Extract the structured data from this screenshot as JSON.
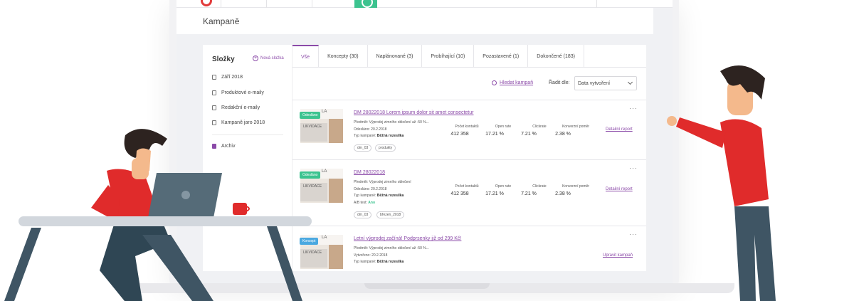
{
  "page": {
    "title": "Kampaně"
  },
  "sidebar": {
    "heading": "Složky",
    "new_folder": "Nová složka",
    "folders": [
      {
        "label": "Září 2018"
      },
      {
        "label": "Produktové e-maily"
      },
      {
        "label": "Redakční e-maily"
      },
      {
        "label": "Kampaně jaro 2018"
      }
    ],
    "archive": "Archiv"
  },
  "tabs": [
    {
      "label": "Vše"
    },
    {
      "label": "Koncepty (30)"
    },
    {
      "label": "Naplánované (3)"
    },
    {
      "label": "Probíhající (10)"
    },
    {
      "label": "Pozastavené (1)"
    },
    {
      "label": "Dokončené (183)"
    }
  ],
  "tools": {
    "search_label": "Hledat kampaň",
    "sort_label": "Řadit dle:",
    "sort_value": "Data vytvoření"
  },
  "stat_labels": {
    "contacts": "Počet kontaktů",
    "open_rate": "Open rate",
    "clickrate": "Clickrate",
    "conversion": "Konverzní poměr"
  },
  "campaigns": [
    {
      "badge": "Odesláno",
      "title": "DM 28022018 Lorem ipsum dolor sit amet consectetur",
      "subject": "Předmět: Výprodej zimního oblečení až -50 %...",
      "sent": "Odesláno: 20.2.2018",
      "type_label": "Typ kampaně:",
      "type_value": "Běžná rozesílka",
      "tags": [
        "dm_03",
        "produkty"
      ],
      "contacts": "412 358",
      "open_rate": "17.21 %",
      "clickrate": "7.21 %",
      "conversion": "2.38 %",
      "action": "Detailní report"
    },
    {
      "badge": "Odesláno",
      "title": "DM 28022018",
      "subject": "Předmět: Výprodej zimního oblečení",
      "sent": "Odesláno: 20.2.2018",
      "type_label": "Typ kampaně:",
      "type_value": "Běžná rozesílka",
      "ab_label": "A/B test:",
      "ab_value": "Ano",
      "tags": [
        "dm_03",
        "březen_2018"
      ],
      "contacts": "412 358",
      "open_rate": "17.21 %",
      "clickrate": "7.21 %",
      "conversion": "2.38 %",
      "action": "Detailní report"
    },
    {
      "badge": "Koncept",
      "title": "Letní výprodej začíná! Podprsenky již od 299 Kč!",
      "subject": "Předmět: Výprodej zimního oblečení až -50 %...",
      "sent": "Vytvořeno: 20.2.2018",
      "type_label": "Typ kampaně:",
      "type_value": "Běžná rozesílka",
      "action": "Upravit kampaň"
    }
  ],
  "thumb": {
    "logo_text": "LA",
    "promo_text": "LIKVIDACE"
  },
  "more_glyph": "···",
  "colors": {
    "accent": "#8b4aa8",
    "sent": "#3cc38f",
    "concept": "#4aa8e0",
    "shirt": "#e02b2b"
  }
}
